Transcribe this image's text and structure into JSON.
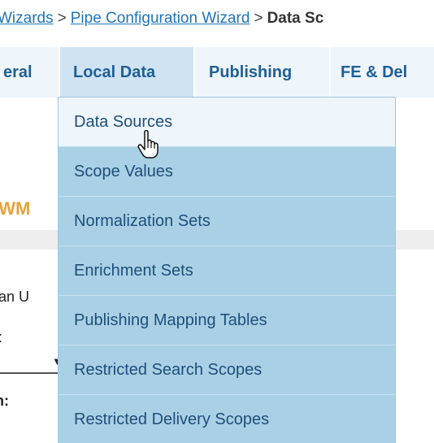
{
  "breadcrumb": {
    "items": [
      "Wizards",
      "Pipe Configuration Wizard"
    ],
    "separator": ">",
    "current": "Data Sc"
  },
  "nav": {
    "tabs": [
      {
        "label": "eral"
      },
      {
        "label": "Local Data"
      },
      {
        "label": "Publishing"
      },
      {
        "label": "FE & Del"
      }
    ],
    "active_tab": "Local Data"
  },
  "dropdown": {
    "items": [
      "Data Sources",
      "Scope Values",
      "Normalization Sets",
      "Enrichment Sets",
      "Publishing Mapping Tables",
      "Restricted Search Scopes",
      "Restricted Delivery Scopes"
    ],
    "hovered_item": "Data Sources"
  },
  "background": {
    "title_fragment": "LWM",
    "label_1": "jan U",
    "label_2": ":",
    "label_3": "n:"
  },
  "colors": {
    "link": "#1f74b8",
    "nav_text": "#1f5f96",
    "menu_bg": "#a9d0e5",
    "menu_hover_bg": "#eef5fb",
    "accent_orange": "#e8a23a"
  }
}
